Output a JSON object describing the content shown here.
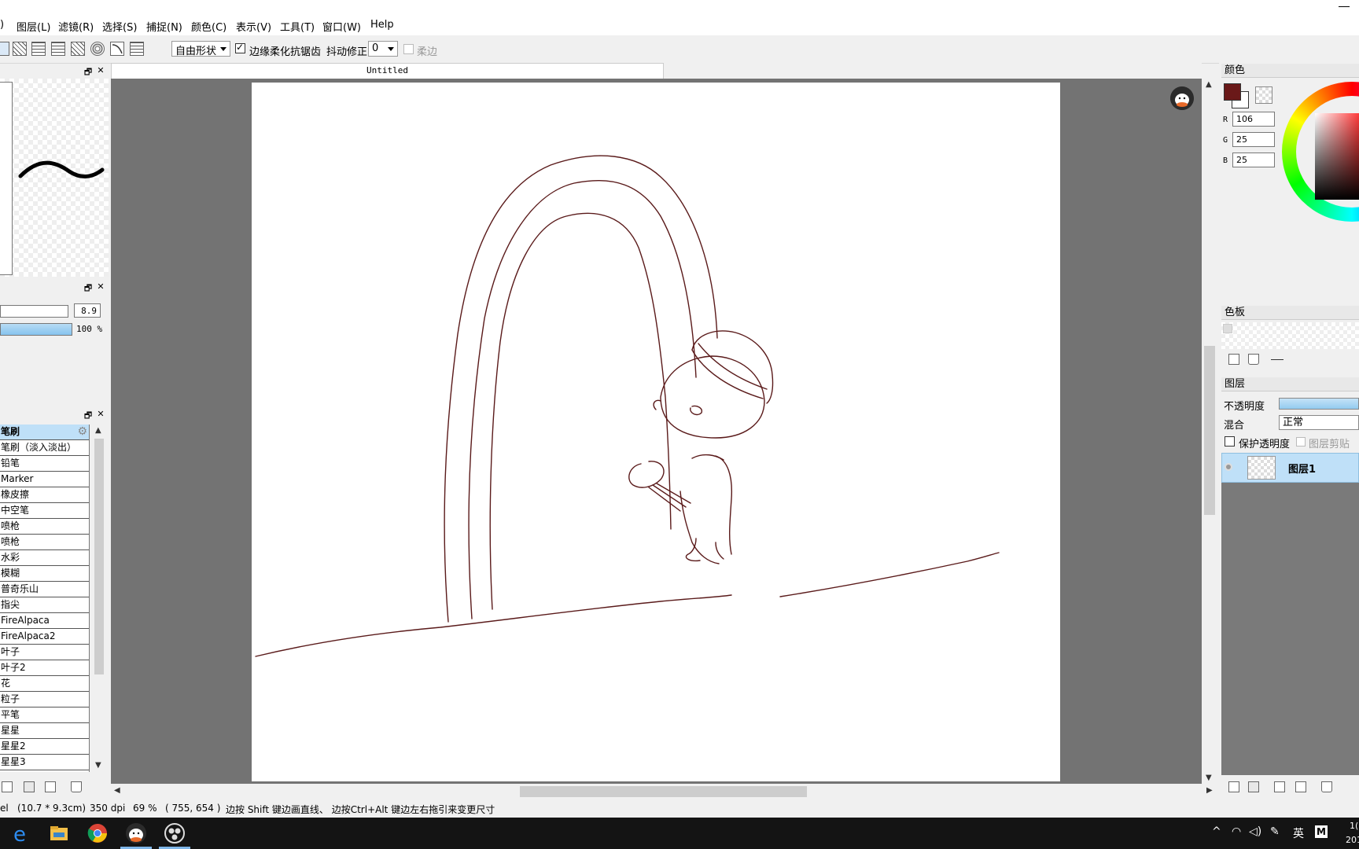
{
  "menu": {
    "items": [
      ")",
      "图层(L)",
      "滤镜(R)",
      "选择(S)",
      "捕捉(N)",
      "颜色(C)",
      "表示(V)",
      "工具(T)",
      "窗口(W)",
      "Help"
    ]
  },
  "toolbar": {
    "shape_mode": "自由形状",
    "antialias_label": "边缘柔化抗锯齿",
    "stabilizer_label": "抖动修正",
    "stabilizer_value": "0",
    "soft_edge_label": "柔边"
  },
  "brush_panel": {
    "size_value": "8.9",
    "opacity_value": "100 %",
    "opacity_fraction": 1.0,
    "items": [
      {
        "label": "笔刷",
        "selected": true
      },
      {
        "label": "笔刷（淡入淡出）"
      },
      {
        "label": "铅笔"
      },
      {
        "label": "Marker"
      },
      {
        "label": "橡皮擦"
      },
      {
        "label": "中空笔"
      },
      {
        "label": "喷枪"
      },
      {
        "label": "喷枪"
      },
      {
        "label": "水彩"
      },
      {
        "label": "模糊"
      },
      {
        "label": "普奇乐山"
      },
      {
        "label": "指尖"
      },
      {
        "label": "FireAlpaca"
      },
      {
        "label": "FireAlpaca2"
      },
      {
        "label": "叶子"
      },
      {
        "label": "叶子2"
      },
      {
        "label": "花"
      },
      {
        "label": "粒子"
      },
      {
        "label": "平笔"
      },
      {
        "label": "星星"
      },
      {
        "label": "星星2"
      },
      {
        "label": "星星3"
      }
    ]
  },
  "document": {
    "tab_title": "Untitled"
  },
  "color_panel": {
    "title": "颜色",
    "r_label": "R",
    "g_label": "G",
    "b_label": "B",
    "r": "106",
    "g": "25",
    "b": "25",
    "fg_color": "#6a1919"
  },
  "palette_panel": {
    "title": "色板"
  },
  "layer_panel": {
    "title": "图层",
    "opacity_label": "不透明度",
    "blend_label": "混合",
    "blend_value": "正常",
    "protect_alpha_label": "保护透明度",
    "clipping_label": "图层剪贴",
    "layer_name": "图层1"
  },
  "status": {
    "unit": "el",
    "size": "(10.7 * 9.3cm)",
    "dpi": "350 dpi",
    "zoom": "69 %",
    "coords": "( 755, 654 )",
    "hint": "边按 Shift 键边画直线、 边按Ctrl+Alt 键边左右拖引来变更尺寸"
  },
  "taskbar": {
    "ime": "英",
    "clock_top": "1(",
    "clock_bottom": "201"
  },
  "colors": {
    "stroke": "#5a1a1a",
    "canvas_bg": "#737373",
    "selection": "#bfe0f8"
  }
}
